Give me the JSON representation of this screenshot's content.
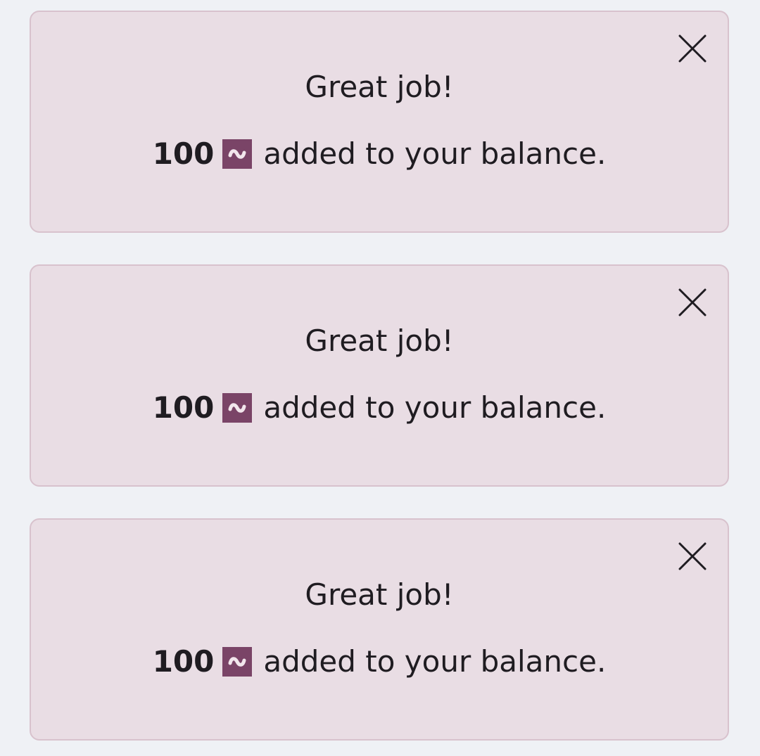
{
  "colors": {
    "background": "#eff1f5",
    "toast_background": "#e9dde4",
    "toast_border": "#d8c2cd",
    "coin": "#7a4467",
    "text": "#1f1c21"
  },
  "toasts": [
    {
      "title": "Great job!",
      "amount": "100",
      "currency_icon": "coin-icon",
      "message": "added to your balance.",
      "close_icon": "close-icon"
    },
    {
      "title": "Great job!",
      "amount": "100",
      "currency_icon": "coin-icon",
      "message": "added to your balance.",
      "close_icon": "close-icon"
    },
    {
      "title": "Great job!",
      "amount": "100",
      "currency_icon": "coin-icon",
      "message": "added to your balance.",
      "close_icon": "close-icon"
    }
  ]
}
